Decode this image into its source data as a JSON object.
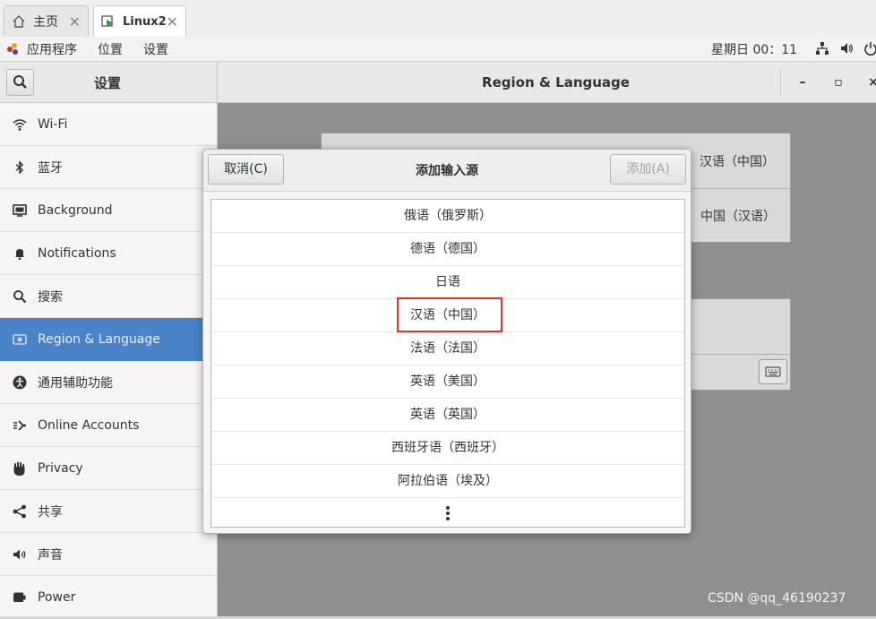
{
  "tabs": [
    {
      "label": "主页",
      "icon": "home-icon"
    },
    {
      "label": "Linux2",
      "icon": "vm-icon"
    }
  ],
  "panel": {
    "applications": "应用程序",
    "places": "位置",
    "settings": "设置",
    "clock": "星期日 00：11"
  },
  "settings_window": {
    "sidebar_title": "设置",
    "title": "Region & Language",
    "controls": {
      "minimize": "–",
      "maximize": "▫",
      "close": "×"
    }
  },
  "sidebar": {
    "items": [
      {
        "label": "Wi-Fi",
        "icon": "wifi-icon"
      },
      {
        "label": "蓝牙",
        "icon": "bluetooth-icon"
      },
      {
        "label": "Background",
        "icon": "background-icon"
      },
      {
        "label": "Notifications",
        "icon": "bell-icon"
      },
      {
        "label": "搜索",
        "icon": "search-icon"
      },
      {
        "label": "Region & Language",
        "icon": "region-icon",
        "selected": true
      },
      {
        "label": "通用辅助功能",
        "icon": "accessibility-icon"
      },
      {
        "label": "Online Accounts",
        "icon": "online-accounts-icon"
      },
      {
        "label": "Privacy",
        "icon": "hand-icon"
      },
      {
        "label": "共享",
        "icon": "share-icon"
      },
      {
        "label": "声音",
        "icon": "speaker-icon"
      },
      {
        "label": "Power",
        "icon": "power-icon"
      }
    ]
  },
  "background_content": {
    "language_value": "汉语（中国）",
    "formats_value": "中国（汉语）"
  },
  "dialog": {
    "title": "添加输入源",
    "cancel_label": "取消(C)",
    "add_label": "添加(A)",
    "languages": [
      "俄语（俄罗斯）",
      "德语（德国）",
      "日语",
      "汉语（中国）",
      "法语（法国）",
      "英语（美国）",
      "英语（英国）",
      "西班牙语（西班牙）",
      "阿拉伯语（埃及）"
    ],
    "highlighted_index": 3,
    "more_icon": "vertical-ellipsis-icon"
  },
  "colors": {
    "selected_sidebar": "#4a83c7",
    "highlight_box": "#e03232"
  },
  "watermark": "CSDN @qq_46190237"
}
